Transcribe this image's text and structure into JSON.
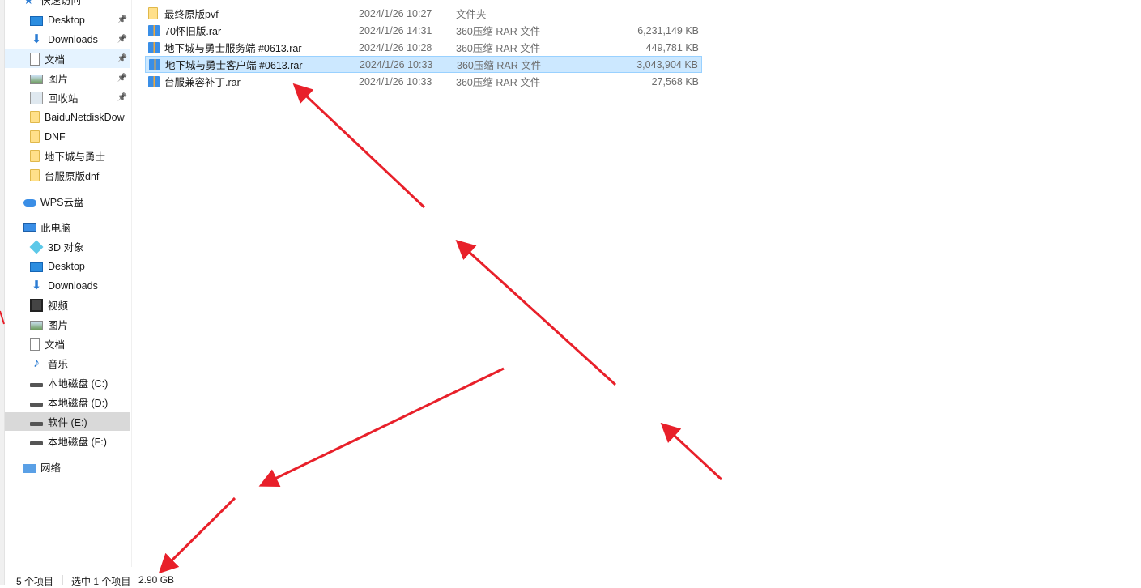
{
  "sidebar": {
    "quick_access": {
      "label": "快速访问",
      "items": [
        {
          "label": "Desktop",
          "icon": "desktop-icon",
          "pinned": true
        },
        {
          "label": "Downloads",
          "icon": "downloads-icon",
          "pinned": true
        },
        {
          "label": "文档",
          "icon": "documents-icon",
          "pinned": true
        },
        {
          "label": "图片",
          "icon": "pictures-icon",
          "pinned": true
        },
        {
          "label": "回收站",
          "icon": "recycle-bin-icon",
          "pinned": true
        },
        {
          "label": "BaiduNetdiskDow",
          "icon": "folder-icon"
        },
        {
          "label": "DNF",
          "icon": "folder-icon"
        },
        {
          "label": "地下城与勇士",
          "icon": "folder-icon"
        },
        {
          "label": "台服原版dnf",
          "icon": "folder-icon"
        }
      ]
    },
    "wps": {
      "label": "WPS云盘"
    },
    "this_pc": {
      "label": "此电脑",
      "items": [
        {
          "label": "3D 对象",
          "icon": "3d-objects-icon"
        },
        {
          "label": "Desktop",
          "icon": "desktop-icon"
        },
        {
          "label": "Downloads",
          "icon": "downloads-icon"
        },
        {
          "label": "视频",
          "icon": "videos-icon"
        },
        {
          "label": "图片",
          "icon": "pictures-icon"
        },
        {
          "label": "文档",
          "icon": "documents-icon"
        },
        {
          "label": "音乐",
          "icon": "music-icon"
        },
        {
          "label": "本地磁盘 (C:)",
          "icon": "drive-icon"
        },
        {
          "label": "本地磁盘 (D:)",
          "icon": "drive-icon"
        },
        {
          "label": "软件 (E:)",
          "icon": "drive-icon",
          "selected": true
        },
        {
          "label": "本地磁盘 (F:)",
          "icon": "drive-icon"
        }
      ]
    },
    "network": {
      "label": "网络"
    }
  },
  "files": [
    {
      "name": "最终原版pvf",
      "date": "2024/1/26 10:27",
      "type": "文件夹",
      "size": "",
      "icon": "folder-icon"
    },
    {
      "name": "70怀旧版.rar",
      "date": "2024/1/26 14:31",
      "type": "360压缩 RAR 文件",
      "size": "6,231,149 KB",
      "icon": "rar-icon"
    },
    {
      "name": "地下城与勇士服务端 #0613.rar",
      "date": "2024/1/26 10:28",
      "type": "360压缩 RAR 文件",
      "size": "449,781 KB",
      "icon": "rar-icon"
    },
    {
      "name": "地下城与勇士客户端 #0613.rar",
      "date": "2024/1/26 10:33",
      "type": "360压缩 RAR 文件",
      "size": "3,043,904 KB",
      "icon": "rar-icon",
      "selected": true
    },
    {
      "name": "台服兼容补丁.rar",
      "date": "2024/1/26 10:33",
      "type": "360压缩 RAR 文件",
      "size": "27,568 KB",
      "icon": "rar-icon"
    }
  ],
  "status": {
    "count": "5 个项目",
    "selected": "选中 1 个项目",
    "size": "2.90 GB"
  },
  "colors": {
    "annotation_arrow": "#e8202a",
    "selection": "#cce8ff",
    "hover": "#e5f3ff"
  }
}
